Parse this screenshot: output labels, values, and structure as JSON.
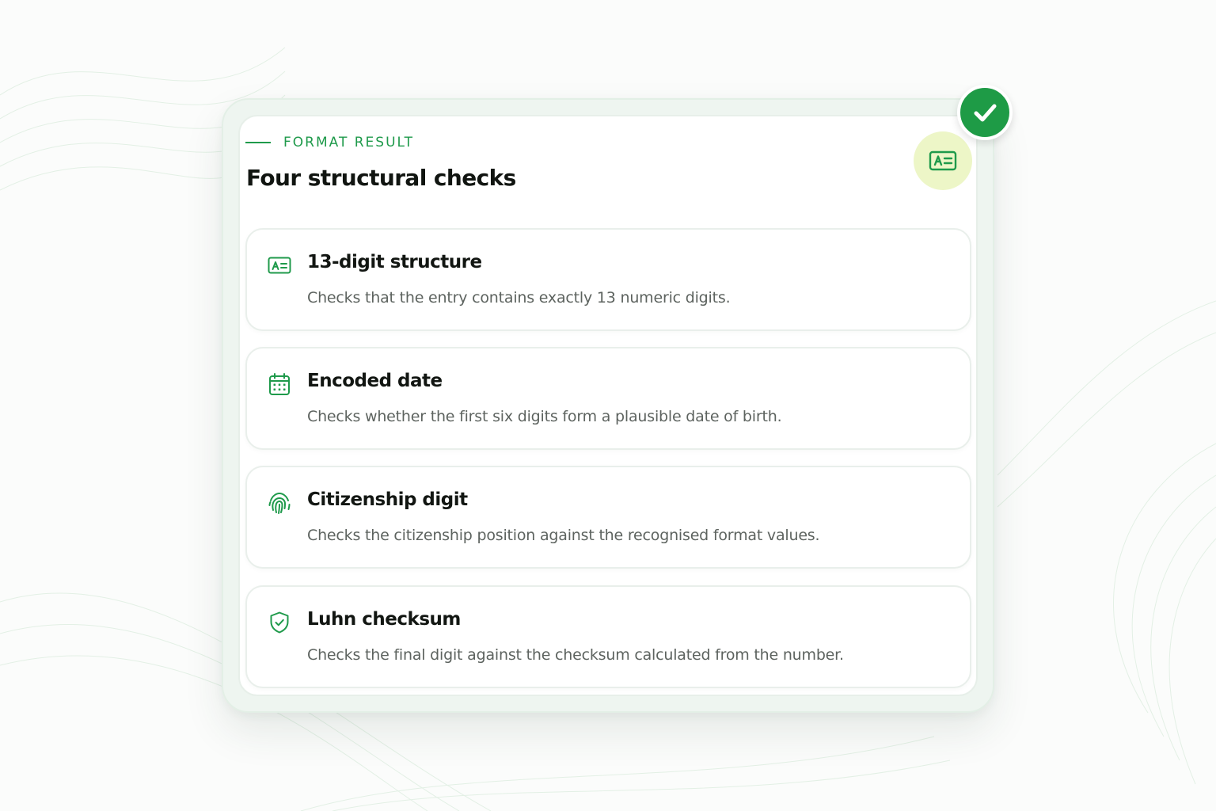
{
  "colors": {
    "accent": "#1f9a4b",
    "badge_background": "#edf6c7",
    "check_badge": "#1e9b46"
  },
  "header": {
    "eyebrow": "FORMAT RESULT",
    "title": "Four structural checks",
    "badge_icon": "id-card-icon",
    "status_icon": "checkmark-icon"
  },
  "checks": [
    {
      "icon": "id-card-icon",
      "title": "13-digit structure",
      "description": "Checks that the entry contains exactly 13 numeric digits."
    },
    {
      "icon": "calendar-icon",
      "title": "Encoded date",
      "description": "Checks whether the first six digits form a plausible date of birth."
    },
    {
      "icon": "fingerprint-icon",
      "title": "Citizenship digit",
      "description": "Checks the citizenship position against the recognised format values."
    },
    {
      "icon": "shield-check-icon",
      "title": "Luhn checksum",
      "description": "Checks the final digit against the checksum calculated from the number."
    }
  ]
}
